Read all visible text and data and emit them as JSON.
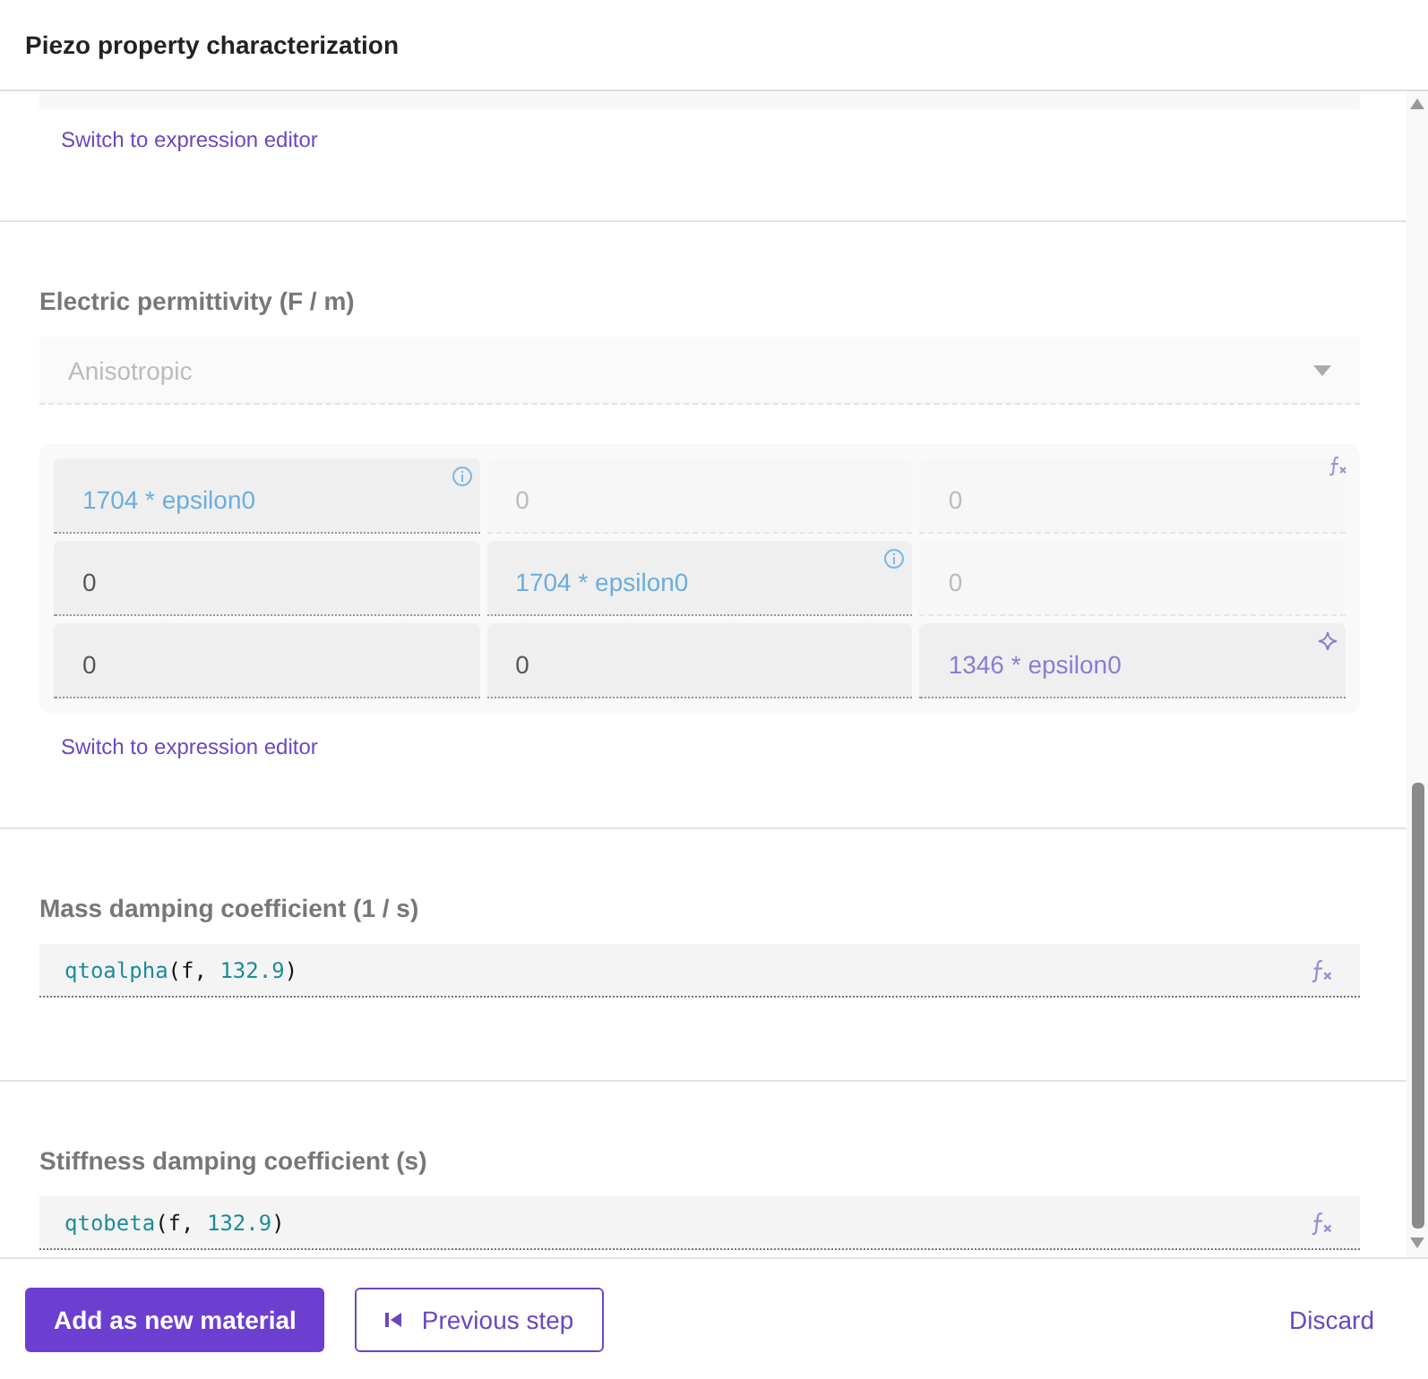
{
  "dialog": {
    "title": "Piezo property characterization"
  },
  "sections": [
    {
      "kind": "tail",
      "link": "Switch to expression editor"
    },
    {
      "kind": "matrix",
      "label": "Electric permittivity (F / m)",
      "select": {
        "value": "Anisotropic",
        "disabled": true
      },
      "rows": [
        [
          {
            "value": "1704 * epsilon0",
            "kind": "linked"
          },
          {
            "value": "0",
            "kind": "disabled"
          },
          {
            "value": "0",
            "kind": "disabled"
          }
        ],
        [
          {
            "value": "0",
            "kind": "plain"
          },
          {
            "value": "1704 * epsilon0",
            "kind": "linked"
          },
          {
            "value": "0",
            "kind": "disabled"
          }
        ],
        [
          {
            "value": "0",
            "kind": "plain"
          },
          {
            "value": "0",
            "kind": "plain"
          },
          {
            "value": "1346 * epsilon0",
            "kind": "source"
          }
        ]
      ],
      "link": "Switch to expression editor"
    },
    {
      "kind": "expression",
      "label": "Mass damping coefficient (1 / s)",
      "tokens": [
        {
          "text": "qtoalpha",
          "kind": "function"
        },
        {
          "text": "(f, ",
          "kind": "plain"
        },
        {
          "text": "132.9",
          "kind": "number"
        },
        {
          "text": ")",
          "kind": "plain"
        }
      ]
    },
    {
      "kind": "expression",
      "label": "Stiffness damping coefficient (s)",
      "tokens": [
        {
          "text": "qtobeta",
          "kind": "function"
        },
        {
          "text": "(f, ",
          "kind": "plain"
        },
        {
          "text": "132.9",
          "kind": "number"
        },
        {
          "text": ")",
          "kind": "plain"
        }
      ]
    }
  ],
  "footer": {
    "primary": "Add as new material",
    "secondary": "Previous step",
    "discard": "Discard"
  }
}
